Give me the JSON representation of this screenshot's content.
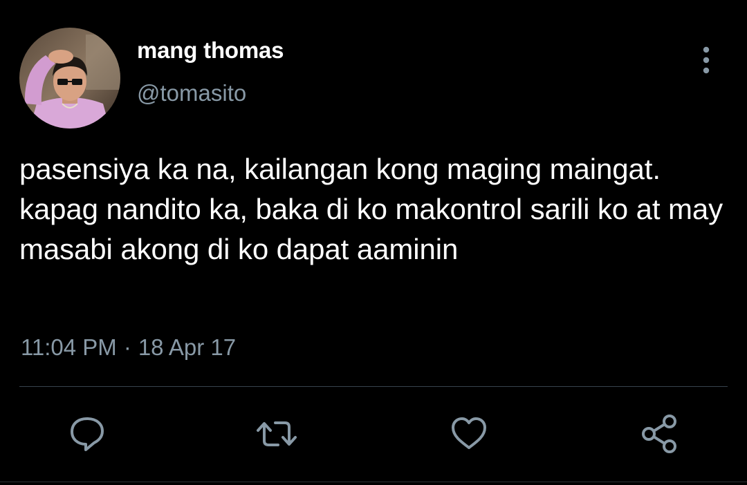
{
  "user": {
    "display_name": "mang thomas",
    "handle": "@tomasito",
    "avatar_icon": "profile-photo"
  },
  "tweet": {
    "text": "pasensiya ka na, kailangan kong maging maingat. kapag nandito ka, baka di ko makontrol sarili ko at may masabi akong di ko dapat aaminin",
    "time": "11:04 PM",
    "separator": "·",
    "date": "18 Apr 17"
  },
  "actions": [
    {
      "name": "reply",
      "icon": "speech-bubble-icon"
    },
    {
      "name": "retweet",
      "icon": "retweet-icon"
    },
    {
      "name": "like",
      "icon": "heart-icon"
    },
    {
      "name": "share",
      "icon": "share-icon"
    }
  ],
  "colors": {
    "background": "#000000",
    "text_primary": "#ffffff",
    "text_secondary": "#8899a6",
    "divider": "#38444d"
  }
}
